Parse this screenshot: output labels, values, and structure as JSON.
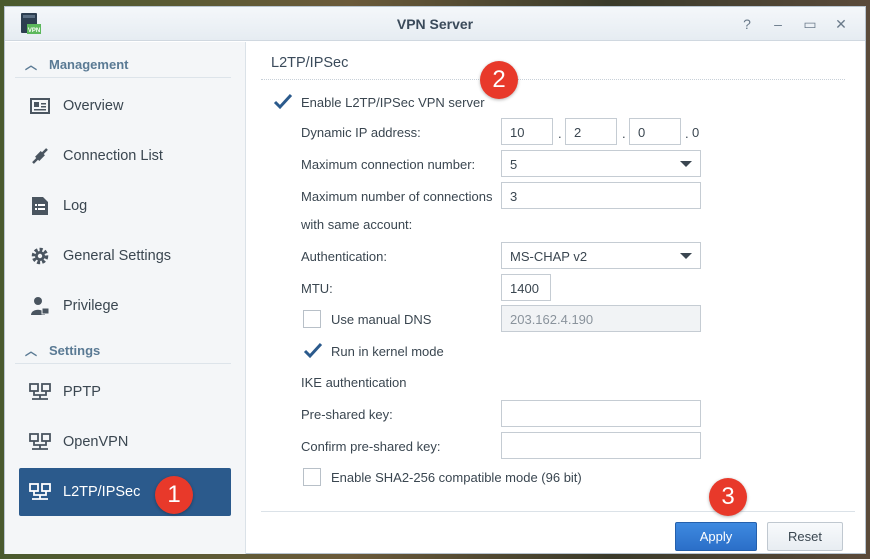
{
  "window": {
    "title": "VPN Server"
  },
  "titlebar": {
    "help": "?",
    "minimize": "–",
    "maximize": "▭",
    "close": "✕"
  },
  "sidebar": {
    "management_label": "Management",
    "settings_label": "Settings",
    "items": [
      {
        "label": "Overview",
        "icon": "overview-icon"
      },
      {
        "label": "Connection List",
        "icon": "connection-list-icon"
      },
      {
        "label": "Log",
        "icon": "log-icon"
      },
      {
        "label": "General Settings",
        "icon": "gear-icon"
      },
      {
        "label": "Privilege",
        "icon": "privilege-icon"
      },
      {
        "label": "PPTP",
        "icon": "network-icon"
      },
      {
        "label": "OpenVPN",
        "icon": "network-icon"
      },
      {
        "label": "L2TP/IPSec",
        "icon": "network-icon",
        "active": true
      }
    ]
  },
  "content": {
    "title": "L2TP/IPSec",
    "enable_label": "Enable L2TP/IPSec VPN server",
    "dynamic_ip_label": "Dynamic IP address:",
    "ip": [
      "10",
      "2",
      "0",
      "0"
    ],
    "ip_dot": ".",
    "max_conn_label": "Maximum connection number:",
    "max_conn_value": "5",
    "max_same_label_1": "Maximum number of connections",
    "max_same_label_2": "with same account:",
    "max_same_value": "3",
    "auth_label": "Authentication:",
    "auth_value": "MS-CHAP v2",
    "mtu_label": "MTU:",
    "mtu_value": "1400",
    "manual_dns_label": "Use manual DNS",
    "manual_dns_value": "203.162.4.190",
    "kernel_label": "Run in kernel mode",
    "ike_label": "IKE authentication",
    "psk_label": "Pre-shared key:",
    "psk_confirm_label": "Confirm pre-shared key:",
    "sha2_label": "Enable SHA2-256 compatible mode (96 bit)"
  },
  "footer": {
    "apply": "Apply",
    "reset": "Reset"
  },
  "annotations": [
    "1",
    "2",
    "3"
  ],
  "colors": {
    "accent": "#2b5a8c",
    "primary_button": "#2b6fc8",
    "badge": "#e8392a"
  }
}
